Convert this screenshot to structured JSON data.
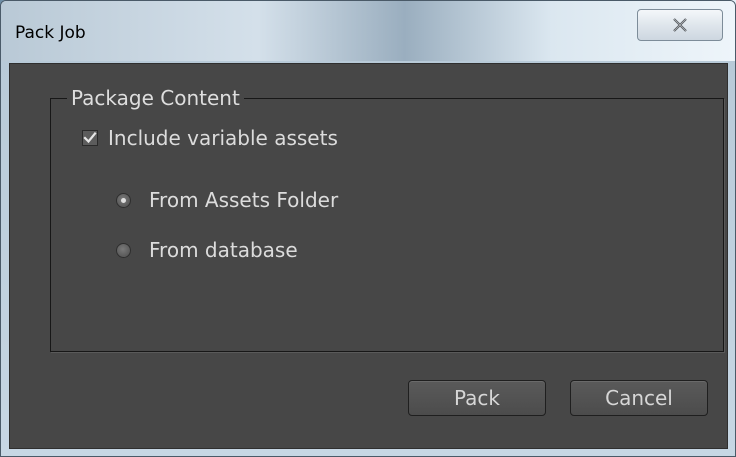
{
  "dialog": {
    "title": "Pack Job",
    "close_icon": "close-icon"
  },
  "package_content": {
    "group_label": "Package Content",
    "include_variable_assets": {
      "label": "Include variable assets",
      "checked": true
    },
    "source_options": [
      {
        "label": "From Assets Folder",
        "selected": true
      },
      {
        "label": "From database",
        "selected": false
      }
    ]
  },
  "buttons": {
    "pack_label": "Pack",
    "cancel_label": "Cancel"
  },
  "colors": {
    "dialog_background": "#474747",
    "text": "#dcdcdc"
  }
}
